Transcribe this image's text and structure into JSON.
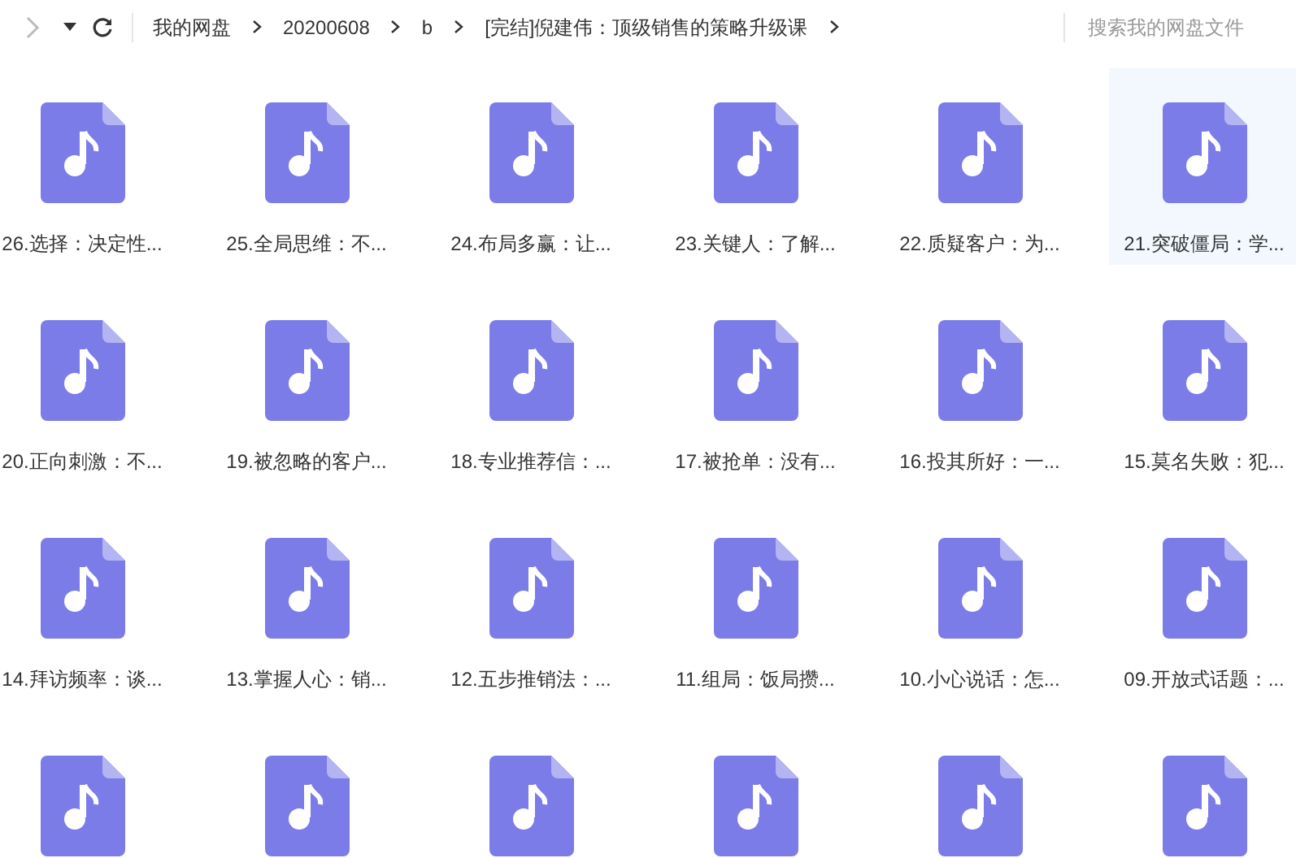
{
  "breadcrumbs": [
    {
      "label": "我的网盘"
    },
    {
      "label": "20200608"
    },
    {
      "label": "b"
    },
    {
      "label": "[完结]倪建伟：顶级销售的策略升级课"
    }
  ],
  "search": {
    "placeholder": "搜索我的网盘文件"
  },
  "files": [
    {
      "name": "26.选择：决定性...",
      "selected": false
    },
    {
      "name": "25.全局思维：不...",
      "selected": false
    },
    {
      "name": "24.布局多赢：让...",
      "selected": false
    },
    {
      "name": "23.关键人：了解...",
      "selected": false
    },
    {
      "name": "22.质疑客户：为...",
      "selected": false
    },
    {
      "name": "21.突破僵局：学...",
      "selected": true
    },
    {
      "name": "20.正向刺激：不...",
      "selected": false
    },
    {
      "name": "19.被忽略的客户...",
      "selected": false
    },
    {
      "name": "18.专业推荐信：...",
      "selected": false
    },
    {
      "name": "17.被抢单：没有...",
      "selected": false
    },
    {
      "name": "16.投其所好：一...",
      "selected": false
    },
    {
      "name": "15.莫名失败：犯...",
      "selected": false
    },
    {
      "name": "14.拜访频率：谈...",
      "selected": false
    },
    {
      "name": "13.掌握人心：销...",
      "selected": false
    },
    {
      "name": "12.五步推销法：...",
      "selected": false
    },
    {
      "name": "11.组局：饭局攒...",
      "selected": false
    },
    {
      "name": "10.小心说话：怎...",
      "selected": false
    },
    {
      "name": "09.开放式话题：...",
      "selected": false
    },
    {
      "selected": false
    },
    {
      "selected": false
    },
    {
      "selected": false
    },
    {
      "selected": false
    },
    {
      "selected": false
    },
    {
      "selected": false
    }
  ]
}
